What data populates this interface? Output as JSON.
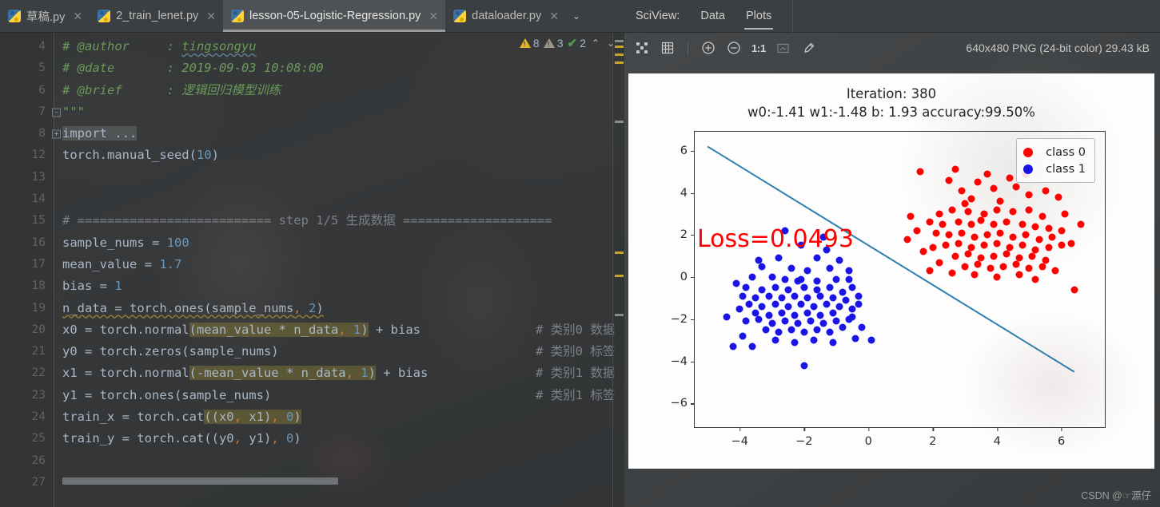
{
  "ide": {
    "tabs": [
      {
        "label": "草稿.py",
        "active": false,
        "closable": true
      },
      {
        "label": "2_train_lenet.py",
        "active": false,
        "closable": true
      },
      {
        "label": "lesson-05-Logistic-Regression.py",
        "active": true,
        "closable": true
      },
      {
        "label": "dataloader.py",
        "active": false,
        "closable": true
      }
    ],
    "tab_overflow_icon": "chevron-down-icon",
    "inspections": {
      "warning_count": "8",
      "weak_warning_count": "3",
      "ok_count": "2",
      "up_arrow": "⌃",
      "down_arrow": "⌄"
    },
    "code_lines": [
      {
        "num": "4",
        "fold": "",
        "tokens": [
          {
            "t": "# @author     : ",
            "c": "cm"
          },
          {
            "t": "tingsongyu",
            "c": "cm spellsq"
          }
        ]
      },
      {
        "num": "5",
        "fold": "",
        "tokens": [
          {
            "t": "# @date       : 2019-09-03 10:08:00",
            "c": "cm"
          }
        ]
      },
      {
        "num": "6",
        "fold": "",
        "tokens": [
          {
            "t": "# @brief      : 逻辑回归模型训练",
            "c": "cm"
          }
        ]
      },
      {
        "num": "7",
        "fold": "-",
        "tokens": [
          {
            "t": "\"\"\"",
            "c": "cm"
          }
        ]
      },
      {
        "num": "8",
        "fold": "+",
        "tokens": [
          {
            "t": "import ...",
            "c": "id selbg"
          }
        ]
      },
      {
        "num": "12",
        "fold": "",
        "tokens": [
          {
            "t": "torch.manual_seed(",
            "c": "id"
          },
          {
            "t": "10",
            "c": "num"
          },
          {
            "t": ")",
            "c": "id"
          }
        ]
      },
      {
        "num": "13",
        "fold": "",
        "tokens": []
      },
      {
        "num": "14",
        "fold": "",
        "tokens": []
      },
      {
        "num": "15",
        "fold": "",
        "tokens": [
          {
            "t": "# ========================== step 1/5 生成数据 ====================",
            "c": "cm2"
          }
        ]
      },
      {
        "num": "16",
        "fold": "",
        "tokens": [
          {
            "t": "sample_nums = ",
            "c": "id"
          },
          {
            "t": "100",
            "c": "num"
          }
        ]
      },
      {
        "num": "17",
        "fold": "",
        "tokens": [
          {
            "t": "mean_value = ",
            "c": "id"
          },
          {
            "t": "1.7",
            "c": "num"
          }
        ]
      },
      {
        "num": "18",
        "fold": "",
        "tokens": [
          {
            "t": "bias = ",
            "c": "id"
          },
          {
            "t": "1",
            "c": "num"
          }
        ]
      },
      {
        "num": "19",
        "fold": "",
        "tokens": [
          {
            "t": "n_data = torch.ones(sample_nums",
            "c": "id squiggle"
          },
          {
            "t": ",",
            "c": "comma squiggle"
          },
          {
            "t": " ",
            "c": "id squiggle"
          },
          {
            "t": "2",
            "c": "num squiggle"
          },
          {
            "t": ")",
            "c": "id squiggle"
          }
        ]
      },
      {
        "num": "20",
        "fold": "",
        "tokens": [
          {
            "t": "x0 = torch.normal",
            "c": "id"
          },
          {
            "t": "(mean_value * n_data",
            "c": "id hl"
          },
          {
            "t": ",",
            "c": "comma hl"
          },
          {
            "t": " ",
            "c": "id hl"
          },
          {
            "t": "1",
            "c": "num hl"
          },
          {
            "t": ")",
            "c": "id hl"
          },
          {
            "t": " + bias",
            "c": "id"
          }
        ],
        "comment": "# 类别0 数据"
      },
      {
        "num": "21",
        "fold": "",
        "tokens": [
          {
            "t": "y0 = torch.zeros(sample_nums)",
            "c": "id"
          }
        ],
        "comment": "# 类别0 标签"
      },
      {
        "num": "22",
        "fold": "",
        "tokens": [
          {
            "t": "x1 = torch.normal",
            "c": "id"
          },
          {
            "t": "(-mean_value * n_data",
            "c": "id hl"
          },
          {
            "t": ",",
            "c": "comma hl"
          },
          {
            "t": " ",
            "c": "id hl"
          },
          {
            "t": "1",
            "c": "num hl"
          },
          {
            "t": ")",
            "c": "id hl"
          },
          {
            "t": " + bias",
            "c": "id"
          }
        ],
        "comment": "# 类别1 数据"
      },
      {
        "num": "23",
        "fold": "",
        "tokens": [
          {
            "t": "y1 = torch.ones(sample_nums)",
            "c": "id"
          }
        ],
        "comment": "# 类别1 标签"
      },
      {
        "num": "24",
        "fold": "",
        "tokens": [
          {
            "t": "train_x = torch.cat",
            "c": "id"
          },
          {
            "t": "((x0",
            "c": "id hl"
          },
          {
            "t": ",",
            "c": "comma hl"
          },
          {
            "t": " x1)",
            "c": "id hl"
          },
          {
            "t": ",",
            "c": "comma hl"
          },
          {
            "t": " ",
            "c": "id hl"
          },
          {
            "t": "0",
            "c": "num hl"
          },
          {
            "t": ")",
            "c": "id hl"
          }
        ]
      },
      {
        "num": "25",
        "fold": "",
        "tokens": [
          {
            "t": "train_y = torch.cat((y0",
            "c": "id"
          },
          {
            "t": ",",
            "c": "comma"
          },
          {
            "t": " y1)",
            "c": "id"
          },
          {
            "t": ",",
            "c": "comma"
          },
          {
            "t": " ",
            "c": "id"
          },
          {
            "t": "0",
            "c": "num"
          },
          {
            "t": ")",
            "c": "id"
          }
        ]
      },
      {
        "num": "26",
        "fold": "",
        "tokens": []
      },
      {
        "num": "27",
        "fold": "",
        "tokens": []
      }
    ]
  },
  "sciview": {
    "label": "SciView:",
    "tabs": [
      {
        "label": "Data",
        "active": false
      },
      {
        "label": "Plots",
        "active": true
      }
    ],
    "toolbar": {
      "fit_icon": "fit-to-window-icon",
      "grid_icon": "grid-icon",
      "zoom_in_icon": "zoom-in-icon",
      "zoom_out_icon": "zoom-out-icon",
      "actual_size_label": "1:1",
      "select_icon": "select-region-icon",
      "color_picker_icon": "eyedropper-icon"
    },
    "file_info": "640x480 PNG (24-bit color) 29.43 kB"
  },
  "watermark": "CSDN @☞源仔",
  "chart_data": {
    "type": "scatter",
    "title": "Iteration: 380\nw0:-1.41 w1:-1.48 b: 1.93 accuracy:99.50%",
    "title_line1": "Iteration: 380",
    "title_line2": "w0:-1.41 w1:-1.48 b: 1.93 accuracy:99.50%",
    "annotation": {
      "text": "Loss=0.0493",
      "color": "#ff0000",
      "x": -4.6,
      "y": 5.2
    },
    "xlabel": "",
    "ylabel": "",
    "xlim": [
      -5.4,
      7.4
    ],
    "ylim": [
      -7.2,
      6.9
    ],
    "xticks": [
      -4,
      -2,
      0,
      2,
      4,
      6
    ],
    "yticks": [
      -6,
      -4,
      -2,
      0,
      2,
      4,
      6
    ],
    "grid": false,
    "legend": {
      "position": "upper right",
      "entries": [
        {
          "label": "class 0",
          "color": "#ff0000"
        },
        {
          "label": "class 1",
          "color": "#1a14e6"
        }
      ]
    },
    "model": {
      "iteration": 380,
      "w0": -1.41,
      "w1": -1.48,
      "b": 1.93,
      "accuracy": "99.50%",
      "loss": 0.0493
    },
    "decision_boundary": {
      "type": "line",
      "points": [
        [
          -5.0,
          6.2
        ],
        [
          6.4,
          -4.5
        ]
      ],
      "color": "#2f7eb0"
    },
    "series": [
      {
        "name": "class 0",
        "color": "#ff0000",
        "points": [
          [
            2.5,
            4.6
          ],
          [
            3.4,
            4.5
          ],
          [
            2.9,
            4.1
          ],
          [
            3.9,
            4.2
          ],
          [
            4.6,
            4.3
          ],
          [
            3.2,
            3.7
          ],
          [
            3.0,
            3.5
          ],
          [
            4.1,
            3.6
          ],
          [
            2.2,
            3.0
          ],
          [
            2.6,
            3.2
          ],
          [
            3.1,
            3.1
          ],
          [
            3.6,
            3.0
          ],
          [
            4.0,
            3.2
          ],
          [
            4.5,
            3.1
          ],
          [
            5.0,
            3.2
          ],
          [
            5.4,
            2.9
          ],
          [
            1.9,
            2.6
          ],
          [
            2.3,
            2.5
          ],
          [
            2.8,
            2.6
          ],
          [
            3.2,
            2.5
          ],
          [
            3.5,
            2.7
          ],
          [
            3.9,
            2.5
          ],
          [
            4.3,
            2.6
          ],
          [
            4.8,
            2.5
          ],
          [
            5.2,
            2.4
          ],
          [
            5.6,
            2.3
          ],
          [
            6.0,
            2.2
          ],
          [
            2.1,
            2.1
          ],
          [
            2.5,
            2.0
          ],
          [
            2.9,
            2.1
          ],
          [
            3.3,
            1.9
          ],
          [
            3.7,
            2.0
          ],
          [
            4.1,
            2.1
          ],
          [
            4.5,
            1.9
          ],
          [
            4.9,
            2.0
          ],
          [
            5.3,
            1.8
          ],
          [
            5.7,
            1.9
          ],
          [
            2.4,
            1.5
          ],
          [
            2.8,
            1.6
          ],
          [
            3.2,
            1.4
          ],
          [
            3.6,
            1.5
          ],
          [
            4.0,
            1.6
          ],
          [
            4.4,
            1.4
          ],
          [
            4.8,
            1.5
          ],
          [
            5.2,
            1.3
          ],
          [
            5.6,
            1.4
          ],
          [
            6.0,
            1.5
          ],
          [
            2.7,
            1.0
          ],
          [
            3.1,
            1.1
          ],
          [
            3.5,
            0.9
          ],
          [
            3.9,
            1.0
          ],
          [
            4.3,
            1.1
          ],
          [
            4.7,
            0.9
          ],
          [
            5.1,
            1.0
          ],
          [
            5.5,
            0.8
          ],
          [
            3.0,
            0.5
          ],
          [
            3.4,
            0.6
          ],
          [
            3.8,
            0.4
          ],
          [
            4.2,
            0.5
          ],
          [
            4.6,
            0.6
          ],
          [
            5.0,
            0.4
          ],
          [
            5.4,
            0.5
          ],
          [
            2.6,
            0.2
          ],
          [
            3.3,
            0.1
          ],
          [
            4.0,
            0.0
          ],
          [
            4.7,
            0.1
          ],
          [
            5.2,
            -0.1
          ],
          [
            5.8,
            0.3
          ],
          [
            6.3,
            1.6
          ],
          [
            6.4,
            -0.6
          ],
          [
            1.6,
            5.0
          ],
          [
            2.7,
            5.1
          ],
          [
            1.3,
            2.9
          ],
          [
            1.5,
            2.2
          ],
          [
            1.2,
            1.8
          ],
          [
            1.7,
            1.2
          ],
          [
            5.9,
            3.8
          ],
          [
            5.0,
            3.9
          ],
          [
            4.4,
            4.7
          ],
          [
            3.7,
            4.9
          ],
          [
            2.2,
            0.7
          ],
          [
            1.9,
            0.3
          ],
          [
            6.6,
            2.5
          ],
          [
            6.1,
            3.0
          ],
          [
            2.0,
            1.4
          ],
          [
            4.9,
            4.9
          ],
          [
            5.5,
            4.1
          ]
        ]
      },
      {
        "name": "class 1",
        "color": "#1a14e6",
        "points": [
          [
            -2.1,
            1.5
          ],
          [
            -2.8,
            0.9
          ],
          [
            -1.6,
            0.9
          ],
          [
            -3.3,
            0.5
          ],
          [
            -2.4,
            0.4
          ],
          [
            -1.9,
            0.3
          ],
          [
            -1.2,
            0.4
          ],
          [
            -3.6,
            0.0
          ],
          [
            -3.0,
            0.0
          ],
          [
            -2.6,
            -0.1
          ],
          [
            -2.1,
            -0.1
          ],
          [
            -1.6,
            -0.2
          ],
          [
            -1.0,
            -0.1
          ],
          [
            -0.6,
            0.3
          ],
          [
            -0.6,
            -0.1
          ],
          [
            -0.5,
            -0.5
          ],
          [
            -3.8,
            -0.5
          ],
          [
            -3.3,
            -0.6
          ],
          [
            -2.9,
            -0.5
          ],
          [
            -2.5,
            -0.6
          ],
          [
            -2.0,
            -0.5
          ],
          [
            -1.6,
            -0.6
          ],
          [
            -1.2,
            -0.5
          ],
          [
            -0.8,
            -0.7
          ],
          [
            -3.9,
            -0.9
          ],
          [
            -3.5,
            -1.0
          ],
          [
            -3.1,
            -0.9
          ],
          [
            -2.7,
            -1.0
          ],
          [
            -2.3,
            -0.9
          ],
          [
            -1.9,
            -1.0
          ],
          [
            -1.5,
            -0.9
          ],
          [
            -1.1,
            -1.0
          ],
          [
            -0.7,
            -1.1
          ],
          [
            -0.3,
            -0.9
          ],
          [
            -3.7,
            -1.3
          ],
          [
            -3.3,
            -1.4
          ],
          [
            -2.9,
            -1.3
          ],
          [
            -2.5,
            -1.4
          ],
          [
            -2.1,
            -1.3
          ],
          [
            -1.7,
            -1.4
          ],
          [
            -1.3,
            -1.3
          ],
          [
            -0.9,
            -1.4
          ],
          [
            -3.5,
            -1.7
          ],
          [
            -3.1,
            -1.8
          ],
          [
            -2.7,
            -1.7
          ],
          [
            -2.3,
            -1.8
          ],
          [
            -1.9,
            -1.7
          ],
          [
            -1.5,
            -1.8
          ],
          [
            -1.1,
            -1.7
          ],
          [
            -3.8,
            -2.1
          ],
          [
            -3.4,
            -2.0
          ],
          [
            -3.0,
            -2.2
          ],
          [
            -2.6,
            -2.1
          ],
          [
            -2.2,
            -2.2
          ],
          [
            -1.8,
            -2.1
          ],
          [
            -1.4,
            -2.2
          ],
          [
            -1.0,
            -2.1
          ],
          [
            -0.6,
            -2.0
          ],
          [
            -3.2,
            -2.5
          ],
          [
            -2.8,
            -2.6
          ],
          [
            -2.4,
            -2.5
          ],
          [
            -2.0,
            -2.6
          ],
          [
            -1.6,
            -2.5
          ],
          [
            -1.2,
            -2.6
          ],
          [
            -0.8,
            -2.4
          ],
          [
            -0.2,
            -2.4
          ],
          [
            -2.9,
            -3.0
          ],
          [
            -2.3,
            -3.1
          ],
          [
            -1.7,
            -3.0
          ],
          [
            -1.1,
            -3.1
          ],
          [
            -0.4,
            -2.9
          ],
          [
            -4.2,
            -3.3
          ],
          [
            -3.6,
            -3.3
          ],
          [
            -2.0,
            -4.2
          ],
          [
            -4.4,
            -1.9
          ],
          [
            -4.0,
            -1.5
          ],
          [
            -3.9,
            -2.8
          ],
          [
            -2.6,
            2.2
          ],
          [
            -1.4,
            1.9
          ],
          [
            -0.5,
            -1.5
          ],
          [
            -0.5,
            -1.9
          ],
          [
            -0.9,
            0.8
          ],
          [
            -1.3,
            1.3
          ],
          [
            -4.1,
            -0.3
          ],
          [
            -0.3,
            -1.3
          ],
          [
            -2.2,
            -0.2
          ],
          [
            -3.4,
            0.8
          ],
          [
            0.1,
            -3.0
          ]
        ]
      }
    ]
  }
}
